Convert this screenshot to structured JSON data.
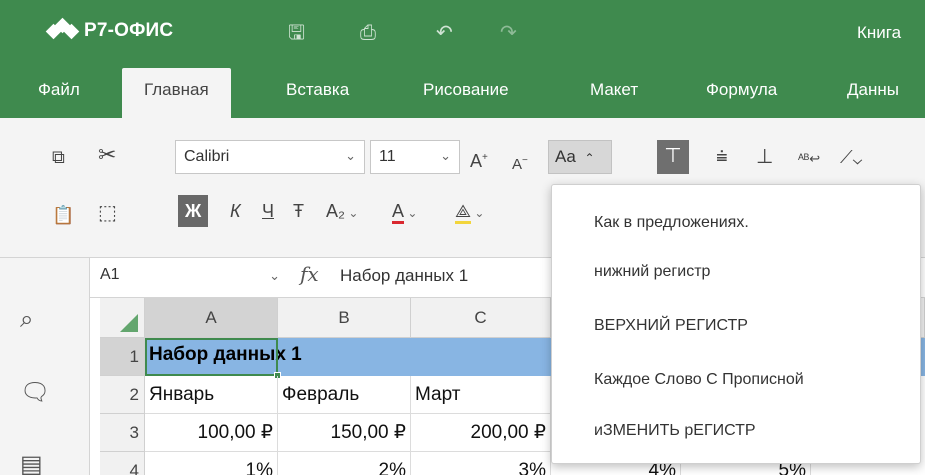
{
  "app": {
    "brand": "Р7-ОФИС",
    "document_title": "Книга"
  },
  "colors": {
    "header_green": "#3f8a4e",
    "selection_blue": "#88b5e3"
  },
  "toolbar_icons": [
    "save-icon",
    "print-icon",
    "undo-icon",
    "redo-icon"
  ],
  "menu": {
    "tabs": [
      "Файл",
      "Главная",
      "Вставка",
      "Рисование",
      "Макет",
      "Формула",
      "Данны"
    ],
    "active": "Главная"
  },
  "ribbon": {
    "font_name": "Calibri",
    "font_size": "11",
    "increase_font": "A",
    "decrease_font": "A",
    "change_case": "Aa",
    "bold": "Ж",
    "italic": "К",
    "underline": "Ч",
    "strike": "Ŧ",
    "subscript": "A₂",
    "font_color": "A"
  },
  "formula_bar": {
    "cell_ref": "A1",
    "fx": "fx",
    "content": "Набор данных 1"
  },
  "grid": {
    "columns": [
      "A",
      "B",
      "C"
    ],
    "rows": [
      {
        "num": "1",
        "cells": [
          "Набор данных 1"
        ]
      },
      {
        "num": "2",
        "cells": [
          "Январь",
          "Февраль",
          "Март"
        ]
      },
      {
        "num": "3",
        "cells": [
          "100,00 ₽",
          "150,00 ₽",
          "200,00 ₽"
        ]
      },
      {
        "num": "4",
        "cells": [
          "1%",
          "2%",
          "3%",
          "4%",
          "5%"
        ]
      }
    ]
  },
  "case_menu": {
    "items": [
      "Как в предложениях.",
      "нижний регистр",
      "ВЕРХНИЙ РЕГИСТР",
      "Каждое Слово С Прописной",
      "иЗМЕНИТЬ рЕГИСТР"
    ]
  }
}
